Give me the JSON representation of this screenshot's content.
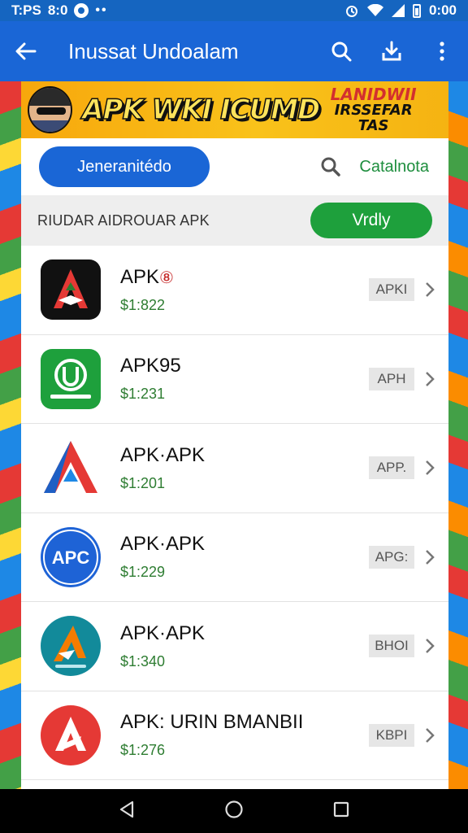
{
  "status_bar": {
    "time_left": "T:PS",
    "label": "8:0",
    "dots": "••",
    "time_right": "0:00"
  },
  "app_bar": {
    "title": "Inussat Undoalam"
  },
  "banner": {
    "title": "APK WKI ICUMD",
    "tag_line1": "LANIDWII",
    "tag_line2": "IRSSEFAR TAS"
  },
  "search": {
    "tab_label": "Jeneranitédo",
    "link_label": "Catalnota"
  },
  "filter": {
    "label": "RIUDAR AIDROUAR APK",
    "button_label": "Vrdly"
  },
  "apps": [
    {
      "name": "APK",
      "badge": "⑧",
      "price": "$1:822",
      "tag": "APKI",
      "icon": "black-a-logo-icon"
    },
    {
      "name": "APK95",
      "badge": "",
      "price": "$1:231",
      "tag": "APH",
      "icon": "green-u-logo-icon"
    },
    {
      "name": "APK·APK",
      "badge": "",
      "price": "$1:201",
      "tag": "APP.",
      "icon": "red-blue-a-logo-icon"
    },
    {
      "name": "APK·APK",
      "badge": "",
      "price": "$1:229",
      "tag": "APG:",
      "icon": "apc-logo-icon"
    },
    {
      "name": "APK·APK",
      "badge": "",
      "price": "$1:340",
      "tag": "BHOI",
      "icon": "orange-a-logo-icon"
    },
    {
      "name": "APK: URIN BMANBII",
      "badge": "",
      "price": "$1:276",
      "tag": "KBPI",
      "icon": "red-a-logo-icon"
    }
  ],
  "app_icon_texts": {
    "apc": "APC"
  },
  "colors": {
    "primary": "#1a66d6",
    "accent_green": "#1ea03c",
    "price_green": "#2e7d32"
  }
}
